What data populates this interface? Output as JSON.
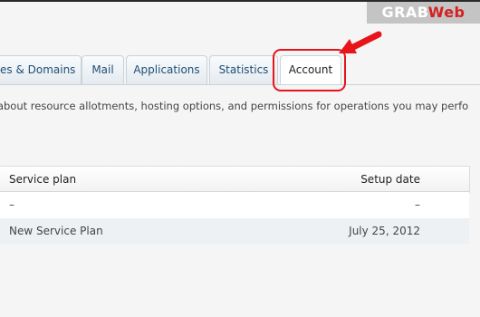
{
  "watermark": {
    "part1": "GRAB",
    "part2": "Web"
  },
  "tabs": [
    {
      "label": "es & Domains"
    },
    {
      "label": "Mail"
    },
    {
      "label": "Applications"
    },
    {
      "label": "Statistics"
    },
    {
      "label": "Account",
      "active": true
    }
  ],
  "description": "n about resource allotments, hosting options, and permissions for operations you may perfo",
  "table": {
    "headers": {
      "plan": "Service plan",
      "date": "Setup date"
    },
    "rows": [
      {
        "plan": "–",
        "date": "–"
      },
      {
        "plan": "New Service Plan",
        "date": "July 25, 2012"
      }
    ]
  },
  "colors": {
    "accent": "#e8141c",
    "tab_text": "#1e4e76"
  },
  "icons": [
    "red-arrow-icon"
  ]
}
